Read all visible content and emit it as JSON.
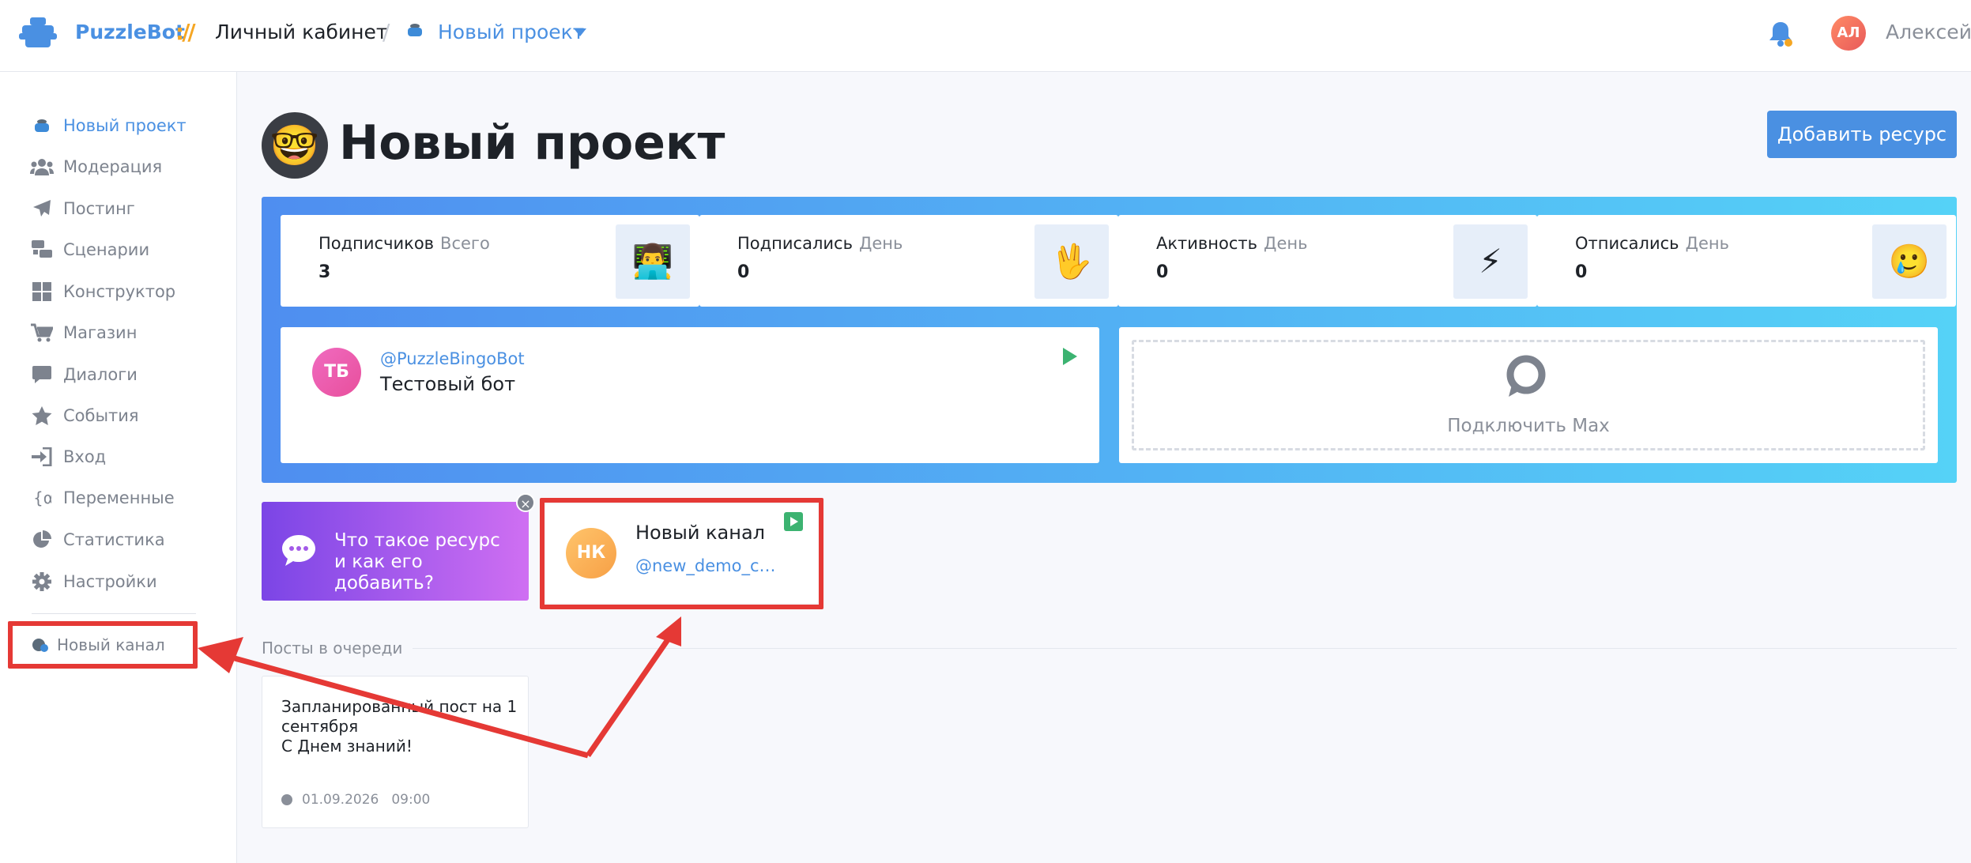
{
  "header": {
    "brand": "PuzzleBot",
    "brand_separator": "://",
    "crumb_cabinet": "Личный кабинет",
    "crumb_slash": "/",
    "crumb_project": "Новый проект",
    "user_initials": "АЛ",
    "user_name": "Алексей"
  },
  "sidebar": {
    "items": [
      {
        "label": "Новый проект",
        "icon": "pot-icon"
      },
      {
        "label": "Модерация",
        "icon": "users-icon"
      },
      {
        "label": "Постинг",
        "icon": "paper-plane-icon"
      },
      {
        "label": "Сценарии",
        "icon": "scenario-icon"
      },
      {
        "label": "Конструктор",
        "icon": "grid-icon"
      },
      {
        "label": "Магазин",
        "icon": "cart-icon"
      },
      {
        "label": "Диалоги",
        "icon": "chat-icon"
      },
      {
        "label": "События",
        "icon": "star-icon"
      },
      {
        "label": "Вход",
        "icon": "sign-in-icon"
      },
      {
        "label": "Переменные",
        "icon": "variable-icon"
      },
      {
        "label": "Статистика",
        "icon": "pie-chart-icon"
      },
      {
        "label": "Настройки",
        "icon": "gear-icon"
      }
    ],
    "channel_item": "Новый канал"
  },
  "project": {
    "emoji": "🤓",
    "title": "Новый проект",
    "add_resource": "Добавить ресурс"
  },
  "stats": [
    {
      "label": "Подписчиков",
      "period": "Всего",
      "value": "3",
      "emoji": "👨‍💻"
    },
    {
      "label": "Подписались",
      "period": "День",
      "value": "0",
      "emoji": "🖖"
    },
    {
      "label": "Активность",
      "period": "День",
      "value": "0",
      "emoji": "⚡"
    },
    {
      "label": "Отписались",
      "period": "День",
      "value": "0",
      "emoji": "🥲"
    }
  ],
  "bot": {
    "initials": "ТБ",
    "username": "@PuzzleBingoBot",
    "name": "Тестовый бот"
  },
  "max": {
    "label": "Подключить Max"
  },
  "info_card": {
    "text": "Что такое ресурс и как его добавить?"
  },
  "channel_card": {
    "initials": "НК",
    "name": "Новый канал",
    "username": "@new_demo_channel"
  },
  "queue": {
    "title": "Посты в очереди",
    "post_text": "Запланированный пост на 1 сентября\nС Днем знаний!",
    "post_date": "01.09.2026",
    "post_time": "09:00"
  },
  "colors": {
    "accent": "#4a90e2",
    "highlight": "#e53935",
    "panel_gradient_start": "#4f8ef0",
    "panel_gradient_end": "#55d2f7"
  }
}
